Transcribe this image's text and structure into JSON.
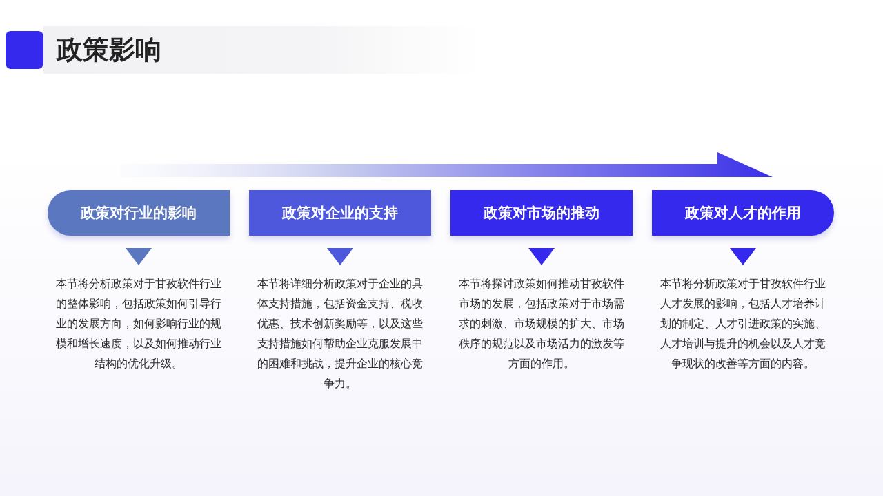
{
  "title": "政策影响",
  "steps": [
    {
      "heading": "政策对行业的影响",
      "color": "#5a77c0",
      "description": "本节将分析政策对于甘孜软件行业的整体影响，包括政策如何引导行业的发展方向，如何影响行业的规模和增长速度，以及如何推动行业结构的优化升级。"
    },
    {
      "heading": "政策对企业的支持",
      "color": "#4d58dc",
      "description": "本节将详细分析政策对于企业的具体支持措施，包括资金支持、税收优惠、技术创新奖励等，以及这些支持措施如何帮助企业克服发展中的困难和挑战，提升企业的核心竞争力。"
    },
    {
      "heading": "政策对市场的推动",
      "color": "#3529ee",
      "description": "本节将探讨政策如何推动甘孜软件市场的发展，包括政策对于市场需求的刺激、市场规模的扩大、市场秩序的规范以及市场活力的激发等方面的作用。"
    },
    {
      "heading": "政策对人才的作用",
      "color": "#3529ee",
      "description": "本节将分析政策对于甘孜软件行业人才发展的影响，包括人才培养计划的制定、人才引进政策的实施、人才培训与提升的机会以及人才竞争现状的改善等方面的内容。"
    }
  ]
}
